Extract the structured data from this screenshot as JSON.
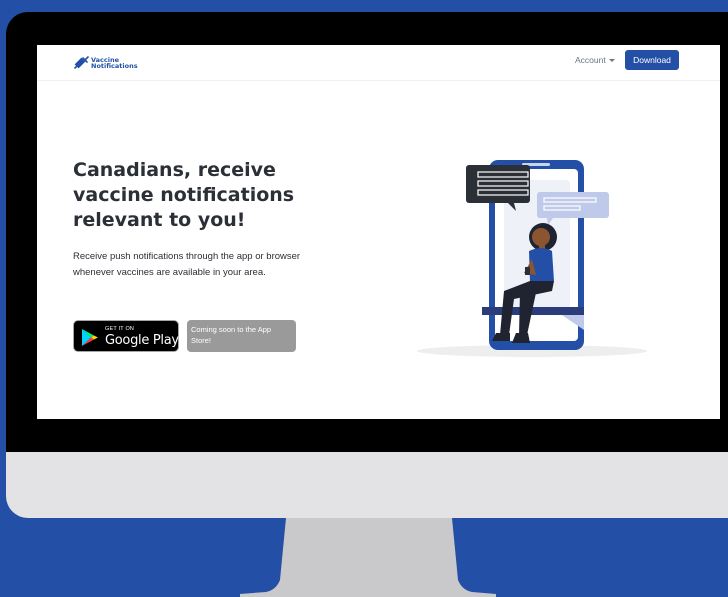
{
  "brand": {
    "logo_text": "Vaccine\nNotifications",
    "logo_icon": "syringe-icon",
    "color": "#2350a6"
  },
  "nav": {
    "account_label": "Account",
    "download_label": "Download"
  },
  "hero": {
    "headline": "Canadians, receive vaccine notifications relevant to you!",
    "subtext": "Receive push notifications through the app or browser whenever vaccines are available in your area."
  },
  "badges": {
    "google_play_small": "GET IT ON",
    "google_play_big": "Google Play",
    "app_store": "Coming soon to the App Store!"
  },
  "colors": {
    "background": "#2350a6",
    "accent": "#2350a6",
    "text": "#2b2f36"
  }
}
